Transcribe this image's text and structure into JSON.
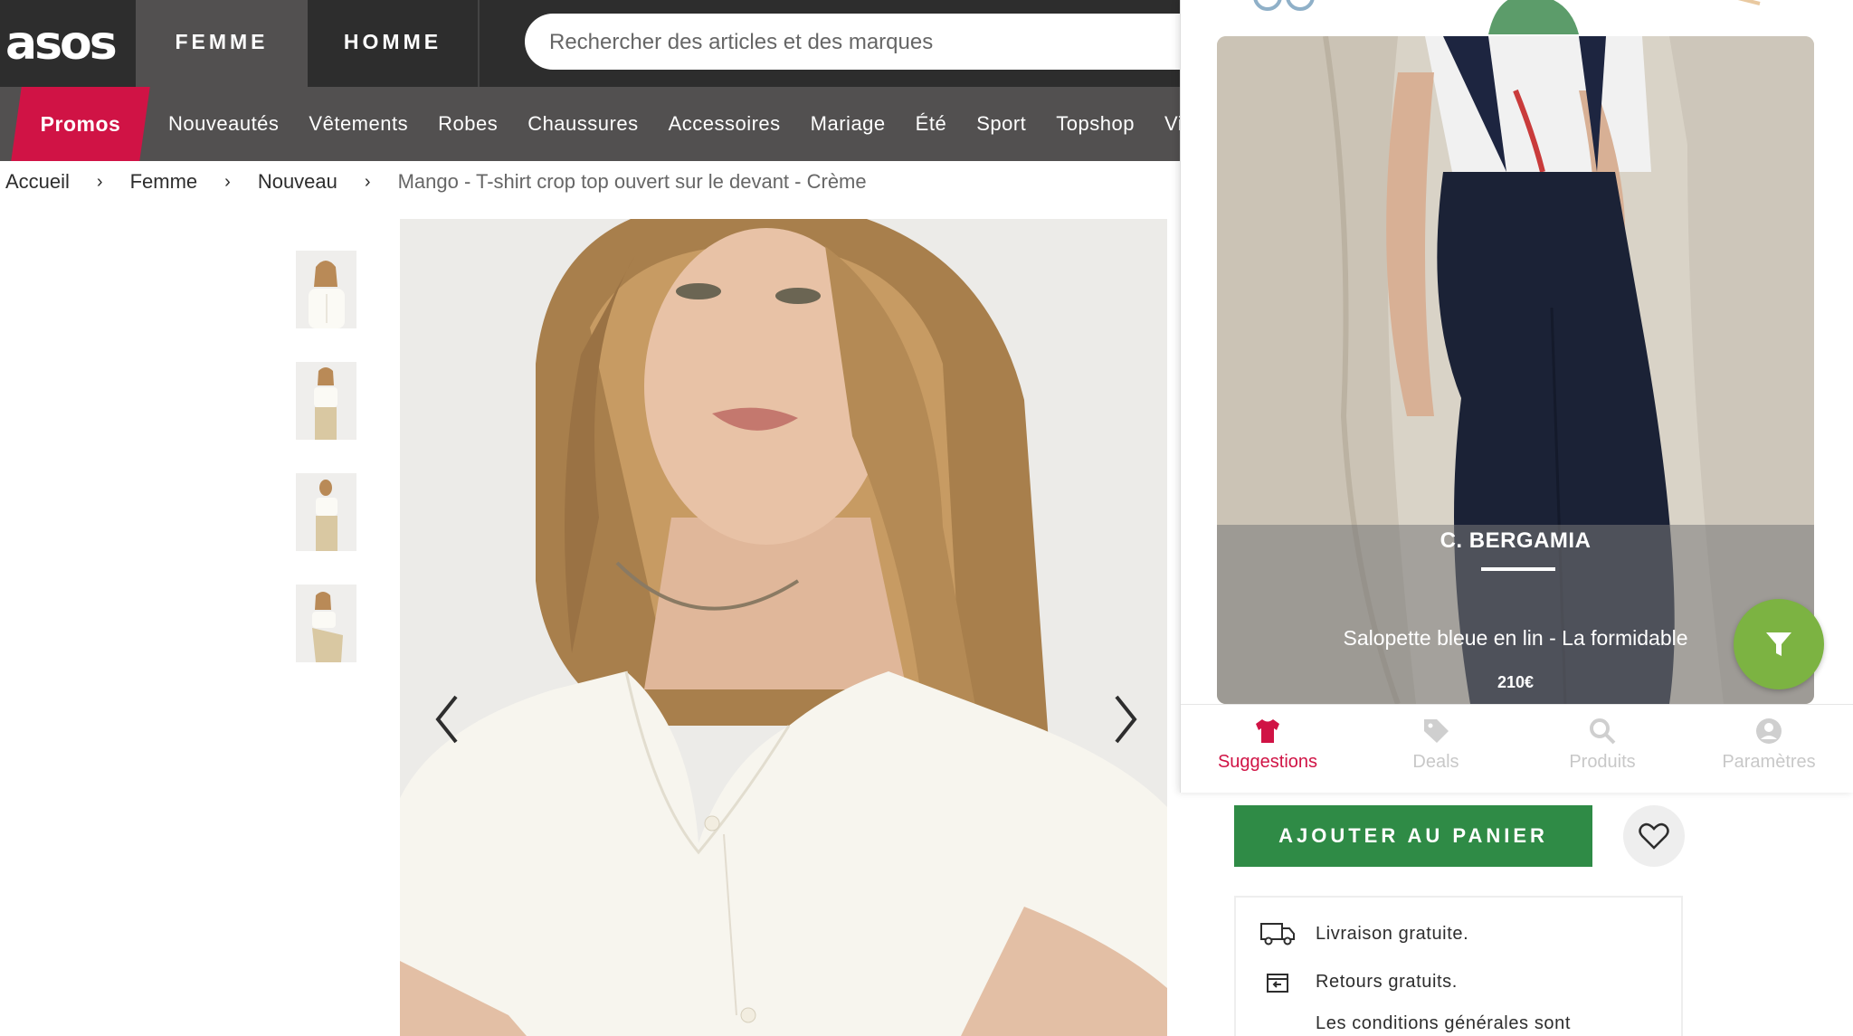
{
  "header": {
    "logo": "asos",
    "tabs": [
      "FEMME",
      "HOMME"
    ],
    "search_placeholder": "Rechercher des articles et des marques"
  },
  "nav": {
    "promos": "Promos",
    "items": [
      "Nouveautés",
      "Vêtements",
      "Robes",
      "Chaussures",
      "Accessoires",
      "Mariage",
      "Été",
      "Sport",
      "Topshop",
      "Visa"
    ]
  },
  "breadcrumb": {
    "items": [
      "Accueil",
      "Femme",
      "Nouveau"
    ],
    "separator": "›",
    "current": "Mango - T-shirt crop top ouvert sur le devant - Crème"
  },
  "product": {
    "add_to_cart": "AJOUTER AU PANIER",
    "delivery": [
      "Livraison gratuite.",
      "Retours gratuits.",
      "Les conditions générales sont"
    ],
    "button_color": "#2f8b46"
  },
  "extension": {
    "card": {
      "brand": "C. BERGAMIA",
      "name": "Salopette bleue en lin - La formidable",
      "price": "210€"
    },
    "tabs": [
      "Suggestions",
      "Deals",
      "Produits",
      "Paramètres"
    ],
    "active_tab": "Suggestions",
    "accent": "#d01345",
    "fab_color": "#7cb342"
  }
}
